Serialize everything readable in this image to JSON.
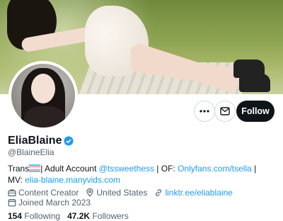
{
  "profile": {
    "display_name": "EliaBlaine",
    "handle": "@BlaineElia",
    "verified": true,
    "bio": {
      "prefix": "Trans",
      "flag_icon": "trans-flag-icon",
      "text1": "| Adult Account ",
      "mention": "@tssweethess",
      "text2": " | OF: ",
      "of_link": "Onlyfans.com/tsella",
      "text3": " | MV: ",
      "mv_link": "elia-blaine.manyvids.com"
    },
    "meta": {
      "category": "Content Creator",
      "location": "United States",
      "website": "linktr.ee/eliablaine",
      "joined": "Joined March 2023"
    },
    "stats": {
      "following_count": "154",
      "following_label": "Following",
      "followers_count": "47.2K",
      "followers_label": "Followers"
    }
  },
  "actions": {
    "more_icon": "more-icon",
    "message_icon": "message-icon",
    "follow_label": "Follow"
  },
  "colors": {
    "link": "#1d9bf0",
    "follow_bg": "#0f1419"
  }
}
